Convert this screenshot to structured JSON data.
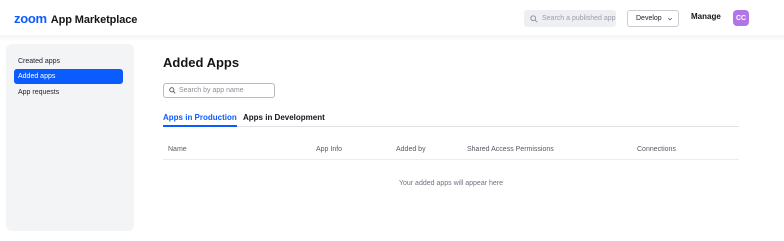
{
  "header": {
    "logo_text": "zoom",
    "title": "App Marketplace",
    "search_placeholder": "Search a published app",
    "develop_label": "Develop",
    "manage_label": "Manage",
    "avatar_initials": "CC",
    "avatar_color": "#b275e8"
  },
  "sidebar": {
    "items": [
      {
        "label": "Created apps",
        "active": false
      },
      {
        "label": "Added apps",
        "active": true
      },
      {
        "label": "App requests",
        "active": false
      }
    ]
  },
  "main": {
    "title": "Added Apps",
    "search_placeholder": "Search by app name",
    "tabs": [
      {
        "label": "Apps in Production",
        "active": true
      },
      {
        "label": "Apps in Development",
        "active": false
      }
    ],
    "columns": [
      "Name",
      "App Info",
      "Added by",
      "Shared Access Permissions",
      "Connections"
    ],
    "empty_message": "Your added apps will appear here"
  },
  "colors": {
    "accent": "#0b5cff",
    "sidebar_bg": "#f3f4f6"
  }
}
